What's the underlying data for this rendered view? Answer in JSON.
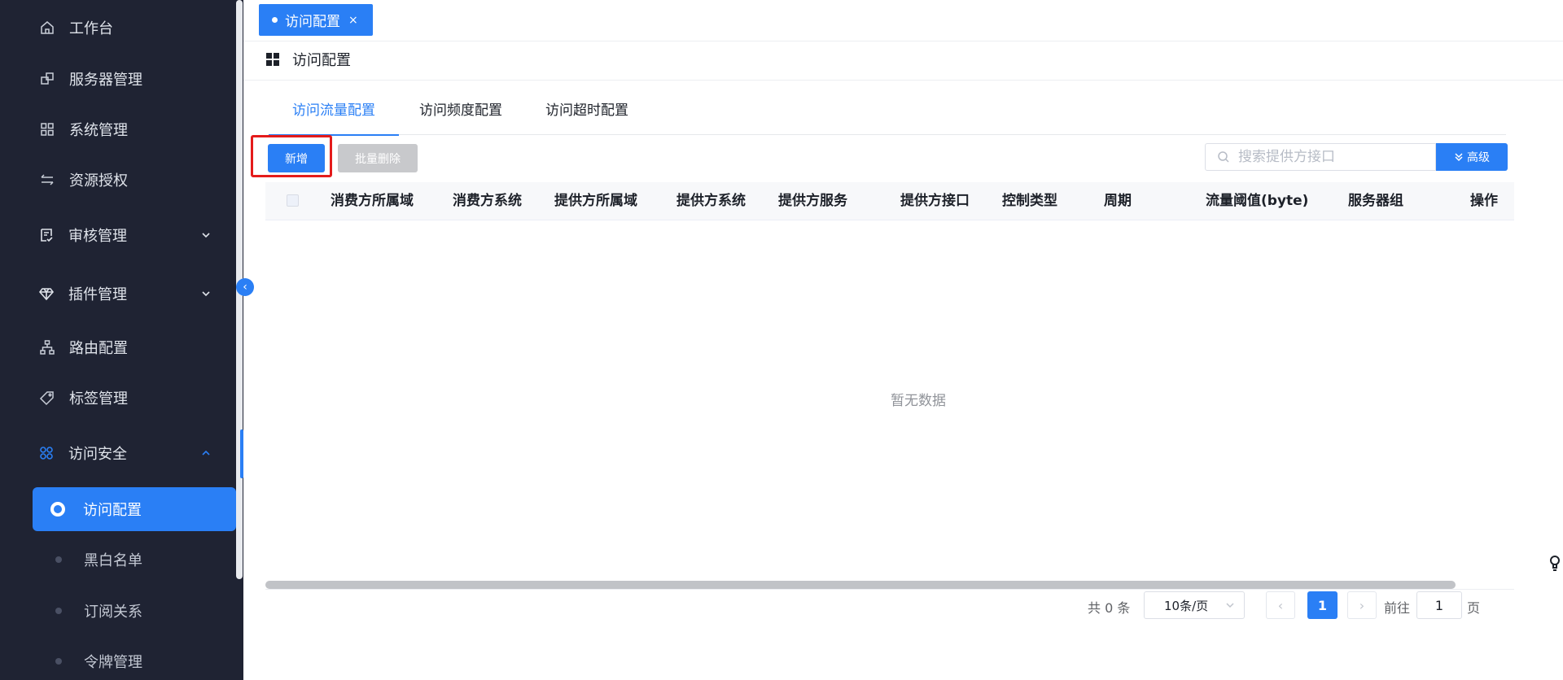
{
  "sidebar": {
    "items": [
      {
        "label": "工作台",
        "icon": "home-icon"
      },
      {
        "label": "服务器管理",
        "icon": "server-icon"
      },
      {
        "label": "系统管理",
        "icon": "grid-icon"
      },
      {
        "label": "资源授权",
        "icon": "transfer-icon"
      },
      {
        "label": "审核管理",
        "icon": "audit-icon"
      },
      {
        "label": "插件管理",
        "icon": "diamond-icon"
      },
      {
        "label": "路由配置",
        "icon": "route-icon"
      },
      {
        "label": "标签管理",
        "icon": "tag-icon"
      },
      {
        "label": "访问安全",
        "icon": "apps-icon"
      }
    ],
    "sub_items": [
      {
        "label": "访问配置",
        "active": true
      },
      {
        "label": "黑白名单"
      },
      {
        "label": "订阅关系"
      },
      {
        "label": "令牌管理"
      }
    ]
  },
  "tabbar": {
    "active_tab": "访问配置",
    "close": "×"
  },
  "breadcrumb": {
    "title": "访问配置"
  },
  "tabs": [
    "访问流量配置",
    "访问频度配置",
    "访问超时配置"
  ],
  "toolbar": {
    "new_label": "新增",
    "batch_delete_label": "批量删除",
    "search_placeholder": "搜索提供方接口",
    "advanced_label": "高级"
  },
  "table": {
    "columns": [
      "消费方所属域",
      "消费方系统",
      "提供方所属域",
      "提供方系统",
      "提供方服务",
      "提供方接口",
      "控制类型",
      "周期",
      "流量阈值(byte)",
      "服务器组",
      "操作"
    ],
    "empty_text": "暂无数据"
  },
  "pagination": {
    "total_text": "共 0 条",
    "page_size": "10条/页",
    "current_page": "1",
    "goto_label": "前往",
    "goto_value": "1",
    "page_unit": "页"
  },
  "colors": {
    "accent": "#2a7ff5",
    "sidebar_bg": "#1f2333",
    "highlight": "#e41b1b"
  }
}
